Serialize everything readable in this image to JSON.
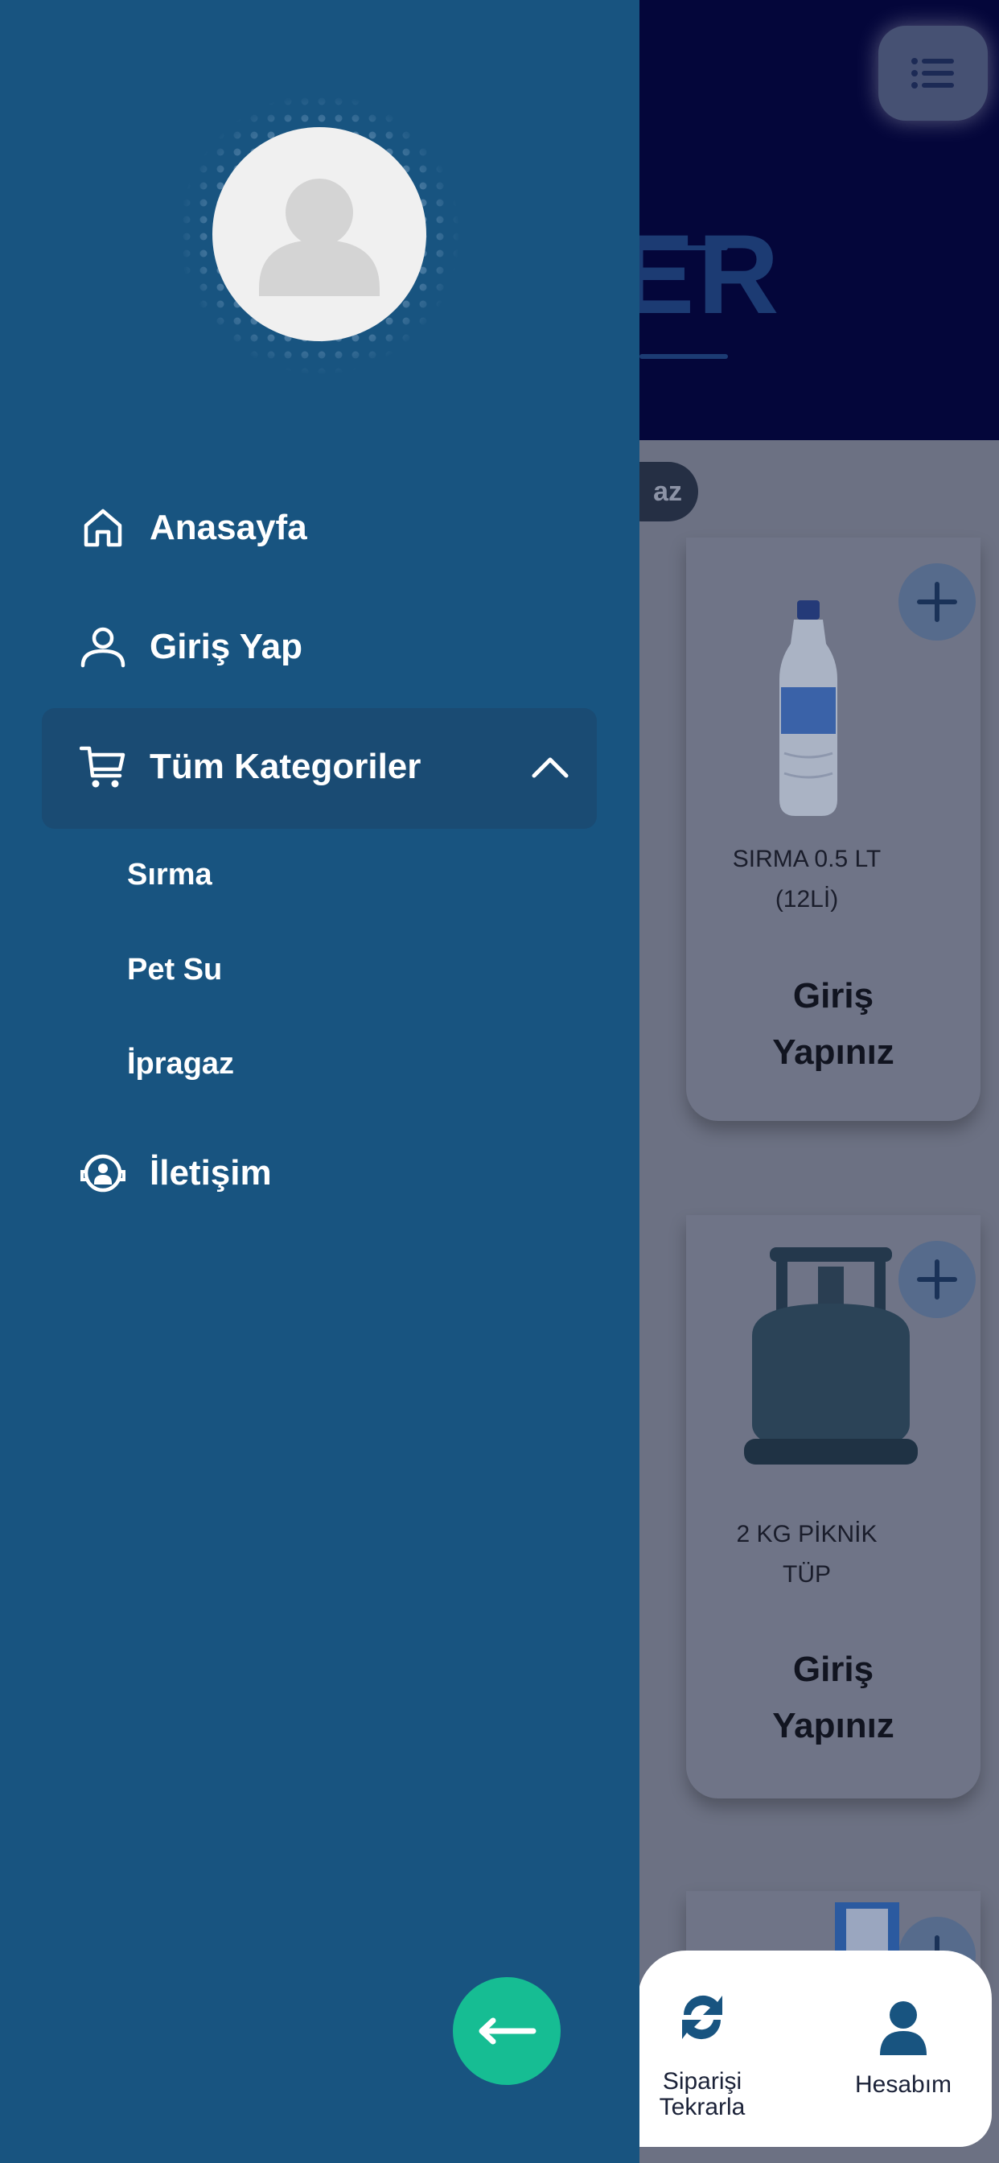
{
  "drawer": {
    "nav": [
      {
        "label": "Anasayfa",
        "icon": "home-icon"
      },
      {
        "label": "Giriş Yap",
        "icon": "user-icon"
      },
      {
        "label": "Tüm Kategoriler",
        "icon": "cart-icon",
        "expanded": true
      },
      {
        "label": "İletişim",
        "icon": "support-icon"
      }
    ],
    "categories": [
      "Sırma",
      "Pet Su",
      "İpragaz"
    ]
  },
  "background": {
    "chip_label": "az",
    "products": [
      {
        "name_line1": "SIRMA 0.5 LT",
        "name_line2": "(12Lİ)",
        "cta_line1": "Giriş",
        "cta_line2": "Yapınız",
        "icon": "water-bottle-icon"
      },
      {
        "name_line1": "2 KG PİKNİK",
        "name_line2": "TÜP",
        "cta_line1": "Giriş",
        "cta_line2": "Yapınız",
        "icon": "gas-cylinder-icon"
      }
    ],
    "bottom_nav": [
      {
        "label_line1": "Siparişi",
        "label_line2": "Tekrarla",
        "icon": "repeat-icon"
      },
      {
        "label_line1": "Hesabım",
        "label_line2": "",
        "icon": "account-icon"
      }
    ]
  },
  "colors": {
    "drawer_bg": "#185480",
    "accent_green": "#16bd93",
    "header_bg": "#04063a"
  }
}
